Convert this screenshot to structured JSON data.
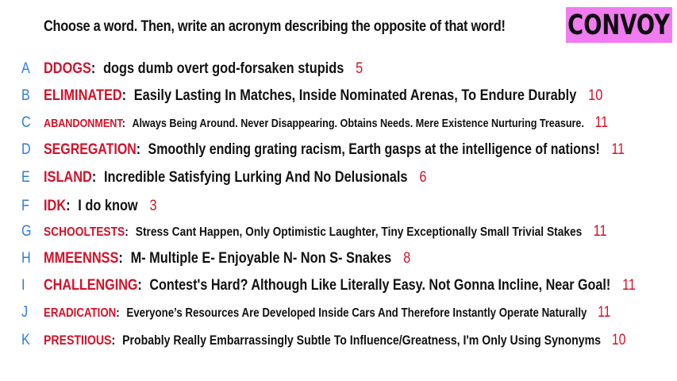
{
  "header": {
    "prompt": "Choose a word. Then, write an acronym describing the opposite of that word!",
    "brand": "CONVOY"
  },
  "entries": [
    {
      "letter": "A",
      "word": "DDOGS",
      "acronym": "dogs dumb overt god-forsaken stupids",
      "count": "5"
    },
    {
      "letter": "B",
      "word": "ELIMINATED",
      "acronym": "Easily Lasting In Matches, Inside Nominated Arenas, To Endure Durably",
      "count": "10"
    },
    {
      "letter": "C",
      "word": "ABANDONMENT",
      "acronym": "Always Being Around. Never Disappearing. Obtains Needs. Mere Existence Nurturing Treasure.",
      "count": "11"
    },
    {
      "letter": "D",
      "word": "SEGREGATION",
      "acronym": "Smoothly ending grating racism, Earth gasps at the intelligence of nations!",
      "count": "11"
    },
    {
      "letter": "E",
      "word": "ISLAND",
      "acronym": "Incredible Satisfying Lurking And No Delusionals",
      "count": "6"
    },
    {
      "letter": "F",
      "word": "IDK",
      "acronym": "I do know",
      "count": "3"
    },
    {
      "letter": "G",
      "word": "SCHOOLTESTS",
      "acronym": "Stress Cant Happen, Only Optimistic Laughter, Tiny Exceptionally Small Trivial Stakes",
      "count": "11"
    },
    {
      "letter": "H",
      "word": "MMEENNSS",
      "acronym": "M- Multiple E- Enjoyable N- Non S- Snakes",
      "count": "8"
    },
    {
      "letter": "I",
      "word": "CHALLENGING",
      "acronym": "Contest's Hard? Although Like Literally Easy. Not Gonna Incline, Near Goal!",
      "count": "11"
    },
    {
      "letter": "J",
      "word": "ERADICATION",
      "acronym": "Everyone’s Resources Are Developed Inside Cars And Therefore Instantly Operate Naturally",
      "count": "11"
    },
    {
      "letter": "K",
      "word": "PRESTIIOUS",
      "acronym": "Probably Really Embarrassingly Subtle To Influence/Greatness, I'm Only Using Synonyms",
      "count": "10"
    }
  ]
}
